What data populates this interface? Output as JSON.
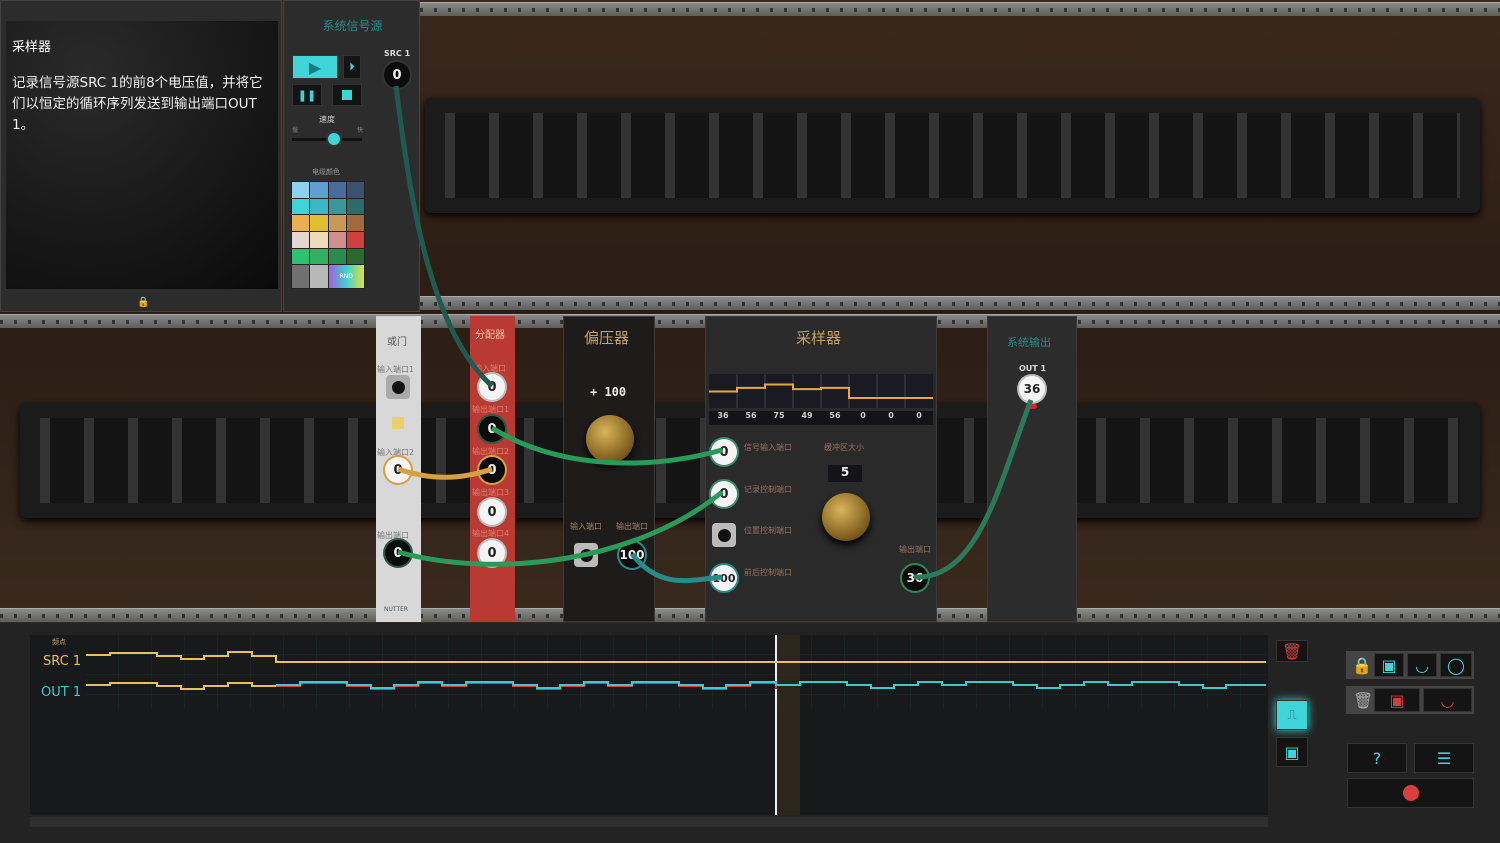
{
  "task": {
    "title": "采样器",
    "description": "记录信号源SRC 1的前8个电压值，并将它们以恒定的循环序列发送到输出端口OUT 1。"
  },
  "source": {
    "title": "系统信号源",
    "speed_label": "速度",
    "speed_min": "慢",
    "speed_max": "快",
    "speed_value": 0.6,
    "color_label": "电缆颜色",
    "rnd_label": "RND",
    "port_label": "SRC 1",
    "port_value": "0",
    "colors": [
      "#8fd0ee",
      "#5fa0d0",
      "#4a6a98",
      "#3c5070",
      "#3ed4d8",
      "#3ab8c8",
      "#3a9898",
      "#2e6a66",
      "#e8b050",
      "#e0c030",
      "#c89a58",
      "#a06a3c",
      "#e4d6d0",
      "#ecdcb8",
      "#d09090",
      "#d04040",
      "#30c070",
      "#30b060",
      "#2a8a50",
      "#2a6a30",
      "#707070",
      "#b8b8b8"
    ]
  },
  "or_gate": {
    "title": "或门",
    "in1": "输入端口1",
    "in2": "输入端口2",
    "in2_value": "0",
    "out": "输出端口",
    "out_value": "0",
    "brand": "NUTTER"
  },
  "distributor": {
    "title": "分配器",
    "in": "输入端口",
    "in_value": "0",
    "outs": [
      {
        "label": "输出端口1",
        "value": "0"
      },
      {
        "label": "输出端口2",
        "value": "0"
      },
      {
        "label": "输出端口3",
        "value": "0"
      },
      {
        "label": "输出端口4",
        "value": "0"
      }
    ]
  },
  "offset": {
    "title": "偏压器",
    "display": "+ 100",
    "in": "输入端口",
    "out": "输出端口",
    "out_value": "100"
  },
  "sampler": {
    "title": "采样器",
    "buffer": [
      "36",
      "56",
      "75",
      "49",
      "56",
      "0",
      "0",
      "0"
    ],
    "signal_in": "信号输入端口",
    "signal_in_value": "0",
    "record": "记录控制端口",
    "record_value": "0",
    "position": "位置控制端口",
    "direction": "前后控制端口",
    "direction_value": "100",
    "buffer_size_label": "缓冲区大小",
    "buffer_size": "5",
    "out": "输出端口",
    "out_value": "36"
  },
  "sys_output": {
    "title": "系统输出",
    "port_label": "OUT 1",
    "port_value": "36"
  },
  "timeline": {
    "header": "频点",
    "tracks": [
      {
        "name": "SRC 1",
        "color": "#e8c060"
      },
      {
        "name": "OUT 1",
        "color": "#40c8d0"
      }
    ]
  },
  "colors": {
    "accent": "#3ed4d8",
    "error": "#d04040",
    "wire_green": "#2a9a5a",
    "wire_yellow": "#d8a040",
    "wire_teal": "#2a8a8a"
  }
}
